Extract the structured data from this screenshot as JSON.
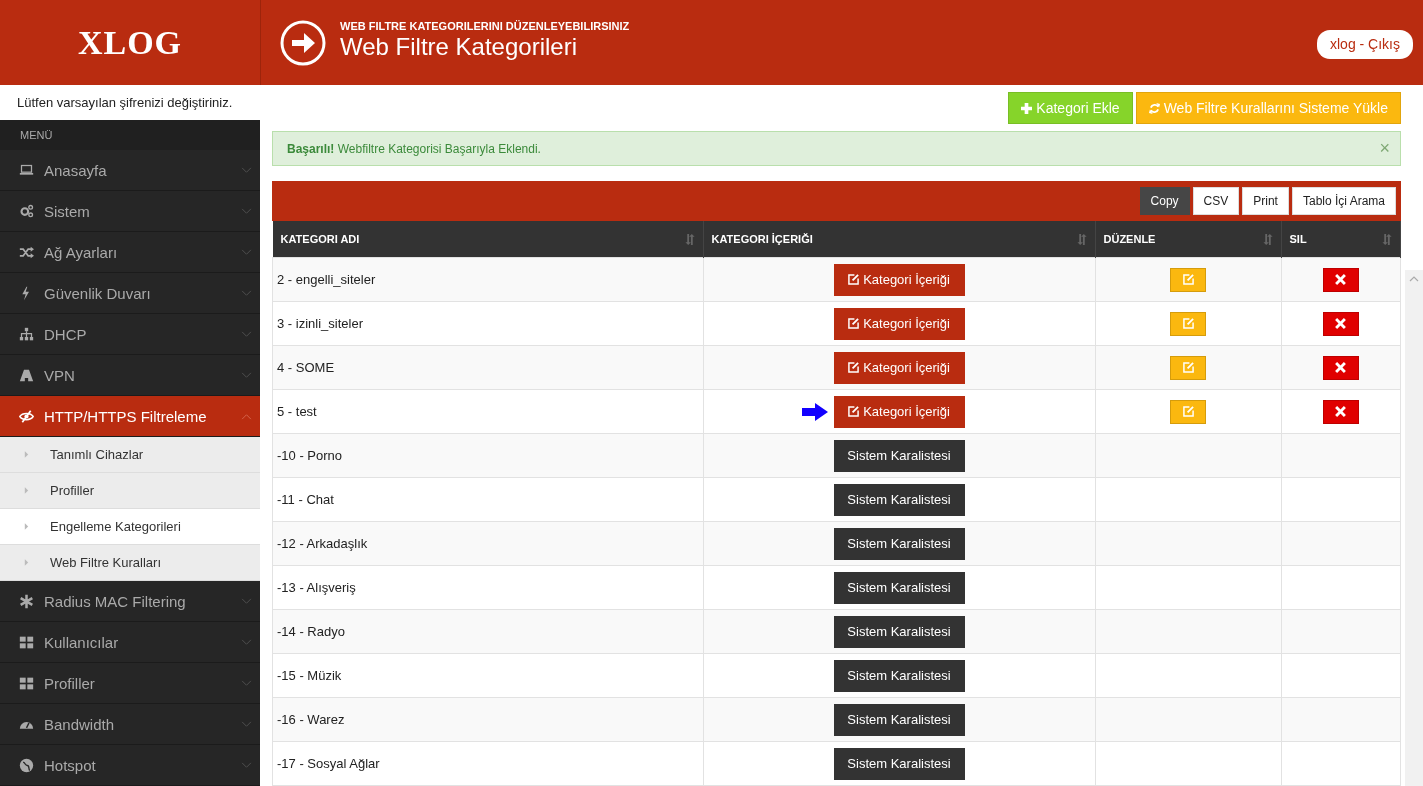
{
  "header": {
    "logo": "XLOG",
    "subtitle": "WEB FILTRE KATEGORILERINI DÜZENLEYEBILIRSINIZ",
    "title": "Web Filtre Kategorileri",
    "user": "xlog",
    "separator": "-",
    "logout": "Çıkış"
  },
  "password_notice": "Lütfen varsayılan şifrenizi değiştiriniz.",
  "sidebar": {
    "heading": "MENÜ",
    "items": [
      {
        "label": "Anasayfa",
        "selected": false,
        "expanded": false
      },
      {
        "label": "Sistem",
        "selected": false,
        "expanded": false
      },
      {
        "label": "Ağ Ayarları",
        "selected": false,
        "expanded": false
      },
      {
        "label": "Güvenlik Duvarı",
        "selected": false,
        "expanded": false
      },
      {
        "label": "DHCP",
        "selected": false,
        "expanded": false
      },
      {
        "label": "VPN",
        "selected": false,
        "expanded": false
      },
      {
        "label": "HTTP/HTTPS Filtreleme",
        "selected": true,
        "expanded": true,
        "children": [
          {
            "label": "Tanımlı Cihazlar",
            "selected": false
          },
          {
            "label": "Profiller",
            "selected": false
          },
          {
            "label": "Engelleme Kategorileri",
            "selected": true
          },
          {
            "label": "Web Filtre Kuralları",
            "selected": false
          }
        ]
      },
      {
        "label": "Radius MAC Filtering",
        "selected": false,
        "expanded": false
      },
      {
        "label": "Kullanıcılar",
        "selected": false,
        "expanded": false
      },
      {
        "label": "Profiller",
        "selected": false,
        "expanded": false
      },
      {
        "label": "Bandwidth",
        "selected": false,
        "expanded": false
      },
      {
        "label": "Hotspot",
        "selected": false,
        "expanded": false
      }
    ]
  },
  "actions": [
    {
      "label": "Kategori Ekle",
      "kind": "add"
    },
    {
      "label": "Web Filtre Kurallarını Sisteme Yükle",
      "kind": "reload"
    }
  ],
  "alert": {
    "strong": "Başarılı!",
    "message": "Webfiltre Kategorisi Başarıyla Eklendi.",
    "close": "×"
  },
  "table_tools": [
    {
      "label": "Copy",
      "selected": true
    },
    {
      "label": "CSV",
      "selected": false
    },
    {
      "label": "Print",
      "selected": false
    },
    {
      "label": "Tablo İçi Arama",
      "selected": false
    }
  ],
  "table": {
    "columns": [
      "KATEGORI ADI",
      "KATEGORI İÇERIĞI",
      "DÜZENLE",
      "SIL"
    ],
    "rows": [
      {
        "name": "2 - engelli_siteler",
        "kind": "user",
        "button": "Kategori İçeriği",
        "pointer": false
      },
      {
        "name": "3 - izinli_siteler",
        "kind": "user",
        "button": "Kategori İçeriği",
        "pointer": false
      },
      {
        "name": "4 - SOME",
        "kind": "user",
        "button": "Kategori İçeriği",
        "pointer": false
      },
      {
        "name": "5 - test",
        "kind": "user",
        "button": "Kategori İçeriği",
        "pointer": true
      },
      {
        "name": "-10 - Porno",
        "kind": "system",
        "button": "Sistem Karalistesi",
        "pointer": false
      },
      {
        "name": "-11 - Chat",
        "kind": "system",
        "button": "Sistem Karalistesi",
        "pointer": false
      },
      {
        "name": "-12 - Arkadaşlık",
        "kind": "system",
        "button": "Sistem Karalistesi",
        "pointer": false
      },
      {
        "name": "-13 - Alışveriş",
        "kind": "system",
        "button": "Sistem Karalistesi",
        "pointer": false
      },
      {
        "name": "-14 - Radyo",
        "kind": "system",
        "button": "Sistem Karalistesi",
        "pointer": false
      },
      {
        "name": "-15 - Müzik",
        "kind": "system",
        "button": "Sistem Karalistesi",
        "pointer": false
      },
      {
        "name": "-16 - Warez",
        "kind": "system",
        "button": "Sistem Karalistesi",
        "pointer": false
      },
      {
        "name": "-17 - Sosyal Ağlar",
        "kind": "system",
        "button": "Sistem Karalistesi",
        "pointer": false
      }
    ]
  }
}
